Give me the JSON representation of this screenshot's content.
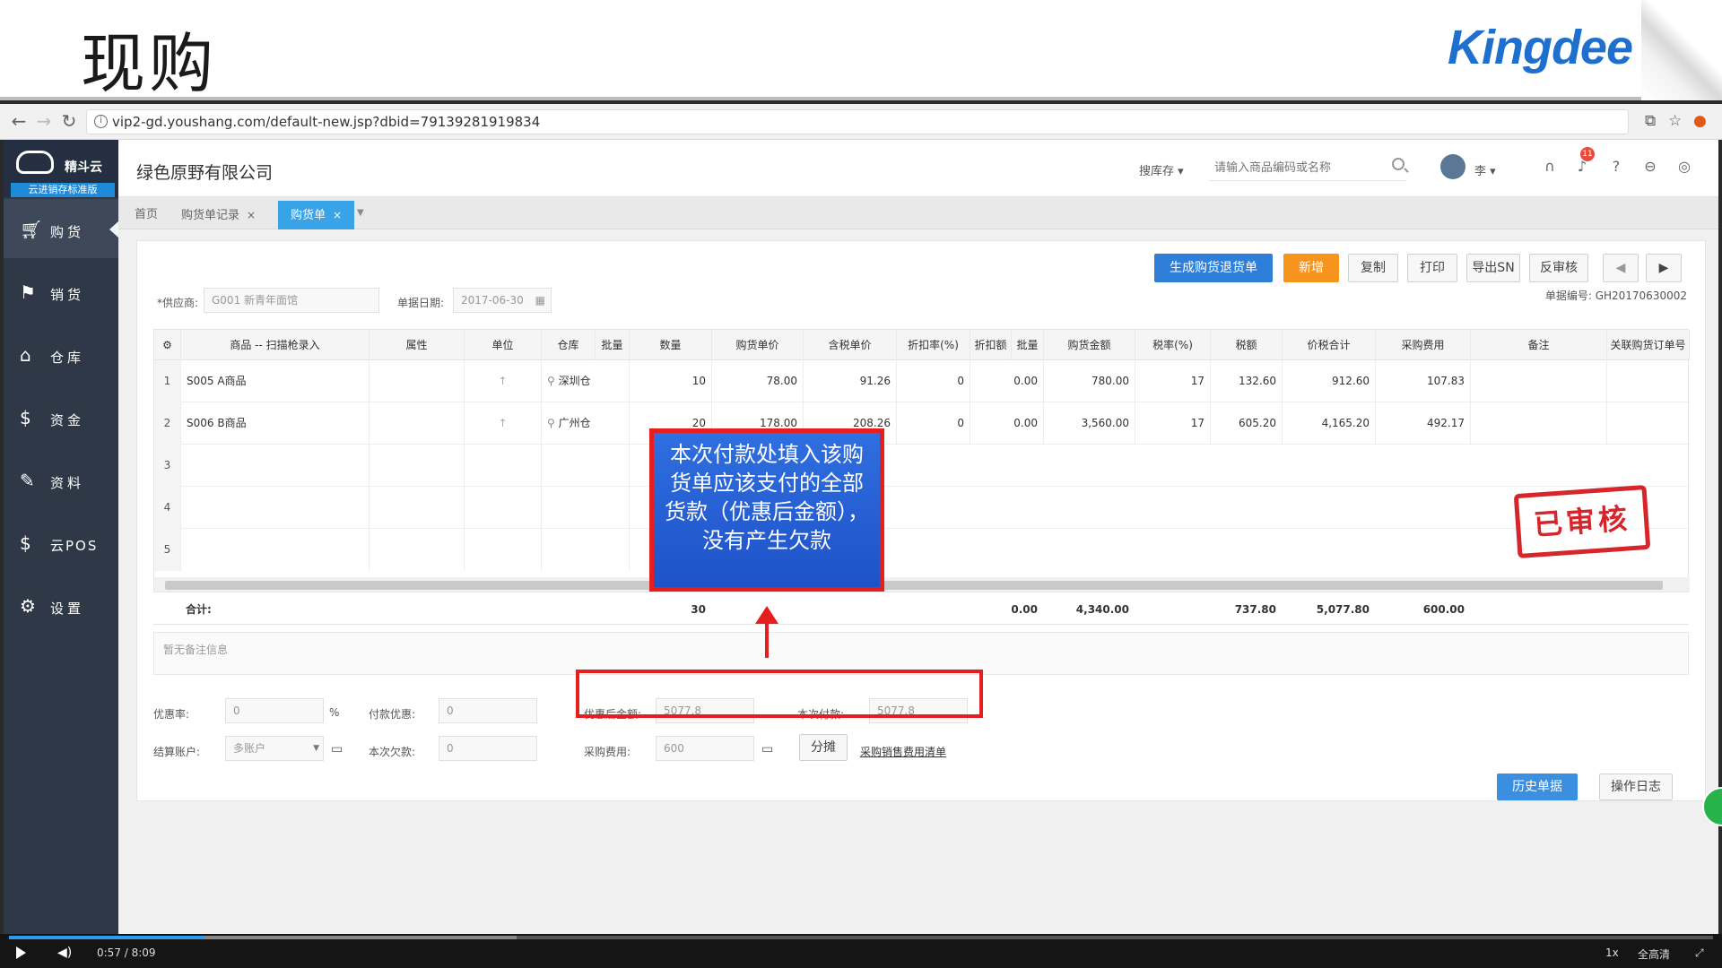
{
  "slide": {
    "title": "现购",
    "logo": "Kingdee"
  },
  "browser": {
    "url": "vip2-gd.youshang.com/default-new.jsp?dbid=79139281919834"
  },
  "sidebar": {
    "brand_name": "精斗云",
    "brand_sub": "云进销存标准版",
    "items": [
      {
        "label": "购货",
        "icon": "cart-icon"
      },
      {
        "label": "销货",
        "icon": "sales-icon"
      },
      {
        "label": "仓库",
        "icon": "warehouse-icon"
      },
      {
        "label": "资金",
        "icon": "money-icon"
      },
      {
        "label": "资料",
        "icon": "pen-icon"
      },
      {
        "label": "云POS",
        "icon": "pos-icon"
      },
      {
        "label": "设置",
        "icon": "gear-icon"
      }
    ]
  },
  "topbar": {
    "company": "绿色原野有限公司",
    "search_scope": "搜库存",
    "search_placeholder": "请输入商品编码或名称",
    "user": "李",
    "notif_count": "11"
  },
  "tabs": [
    {
      "label": "首页"
    },
    {
      "label": "购货单记录"
    },
    {
      "label": "购货单"
    }
  ],
  "actions": {
    "gen_return": "生成购货退货单",
    "new": "新增",
    "copy": "复制",
    "print": "打印",
    "export_sn": "导出SN",
    "unaudit": "反审核"
  },
  "form": {
    "supplier_label": "*供应商:",
    "supplier_value": "G001 新青年面馆",
    "date_label": "单据日期:",
    "date_value": "2017-06-30",
    "doc_no_label": "单据编号:",
    "doc_no_value": "GH20170630002"
  },
  "table": {
    "headers": [
      "",
      "商品 -- 扫描枪录入",
      "属性",
      "单位",
      "仓库",
      "批量",
      "数量",
      "购货单价",
      "含税单价",
      "折扣率(%)",
      "折扣额",
      "批量",
      "购货金额",
      "税率(%)",
      "税额",
      "价税合计",
      "采购费用",
      "备注",
      "关联购货订单号"
    ],
    "rows": [
      {
        "no": "1",
        "item": "S005 A商品",
        "warehouse": "深圳仓",
        "qty": "10",
        "price": "78.00",
        "tax_price": "91.26",
        "discount_rate": "0",
        "discount_amt": "0.00",
        "amount": "780.00",
        "tax_rate": "17",
        "tax": "132.60",
        "total": "912.60",
        "fee": "107.83"
      },
      {
        "no": "2",
        "item": "S006 B商品",
        "warehouse": "广州仓",
        "qty": "20",
        "price": "178.00",
        "tax_price": "208.26",
        "discount_rate": "0",
        "discount_amt": "0.00",
        "amount": "3,560.00",
        "tax_rate": "17",
        "tax": "605.20",
        "total": "4,165.20",
        "fee": "492.17"
      },
      {
        "no": "3"
      },
      {
        "no": "4"
      },
      {
        "no": "5"
      }
    ],
    "totals": {
      "label": "合计:",
      "qty": "30",
      "discount_amt": "0.00",
      "amount": "4,340.00",
      "tax": "737.80",
      "total": "5,077.80",
      "fee": "600.00"
    }
  },
  "remark_placeholder": "暂无备注信息",
  "stamp": "已审核",
  "footer": {
    "discount_rate_label": "优惠率:",
    "discount_rate_value": "0",
    "percent": "%",
    "pay_discount_label": "付款优惠:",
    "pay_discount_value": "0",
    "after_discount_label": "优惠后金额:",
    "after_discount_value": "5077.8",
    "pay_now_label": "本次付款:",
    "pay_now_value": "5077.8",
    "account_label": "结算账户:",
    "account_value": "多账户",
    "debt_label": "本次欠款:",
    "debt_value": "0",
    "purchase_fee_label": "采购费用:",
    "purchase_fee_value": "600",
    "split_btn": "分摊",
    "fee_link": "采购销售费用清单",
    "history_btn": "历史单据",
    "log_btn": "操作日志"
  },
  "callout": "本次付款处填入该购货单应该支付的全部货款（优惠后金额），没有产生欠款",
  "video": {
    "time": "0:57 / 8:09",
    "speed": "1x",
    "quality": "全高清"
  }
}
